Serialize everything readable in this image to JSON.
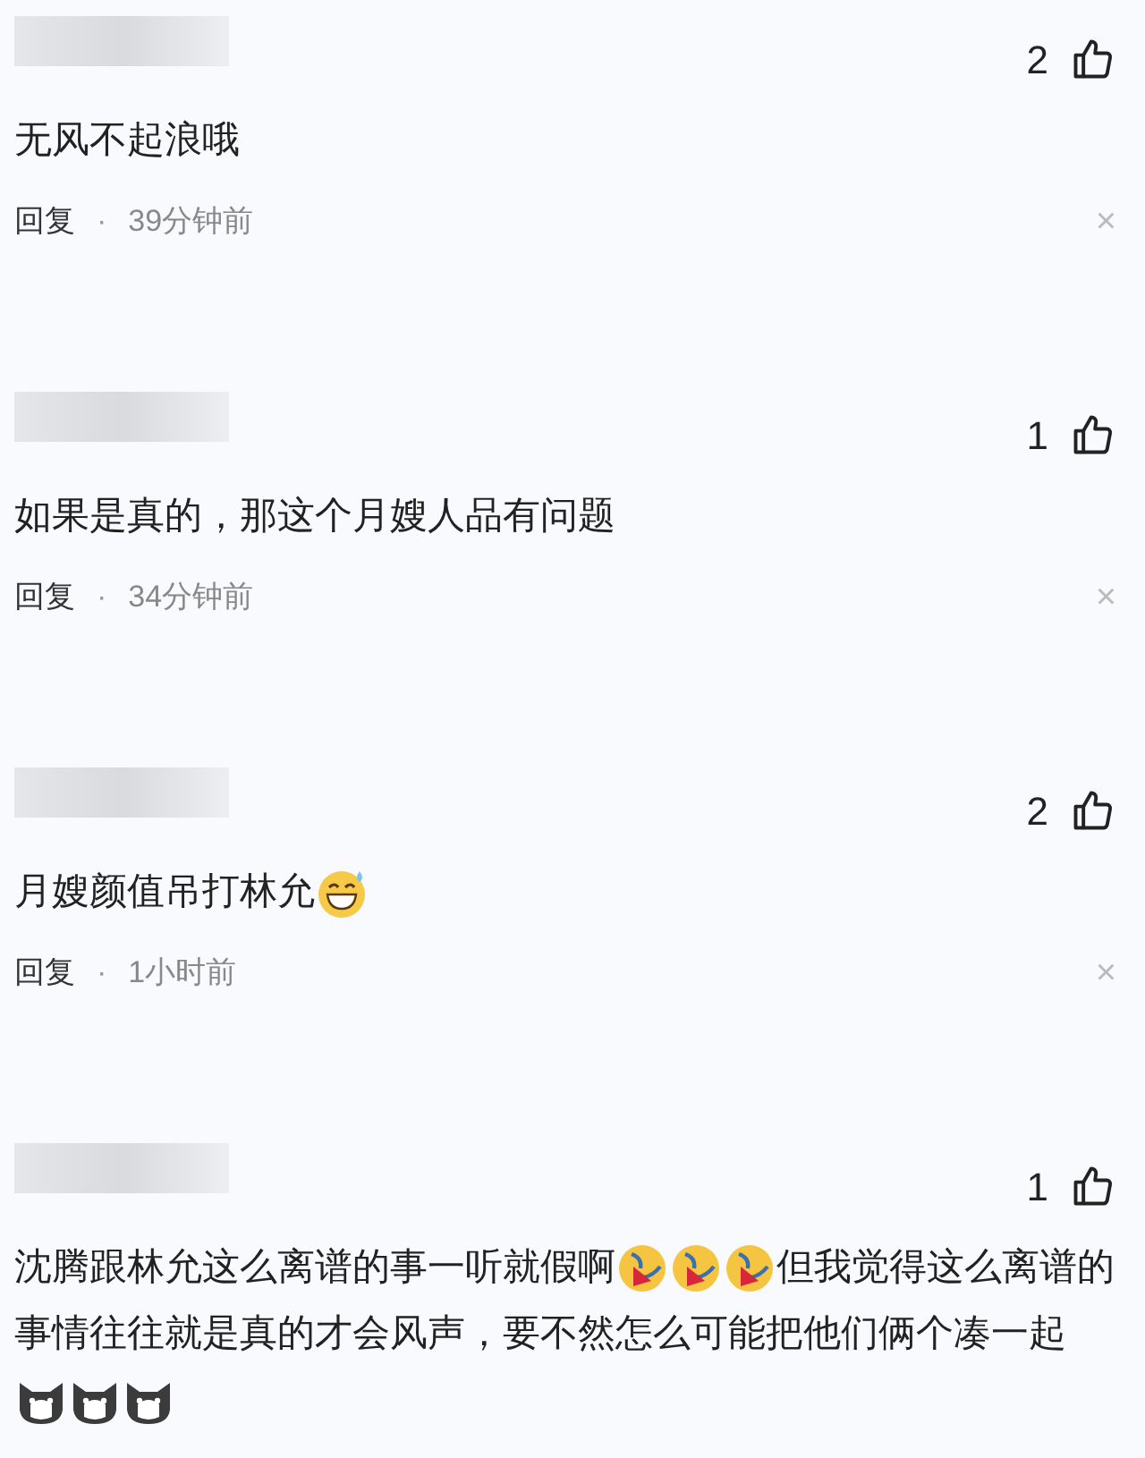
{
  "comments": [
    {
      "likes": "2",
      "body": [
        {
          "kind": "text",
          "text": "无风不起浪哦"
        }
      ],
      "reply": "回复",
      "separator": "·",
      "time": "39分钟前",
      "close": "×"
    },
    {
      "likes": "1",
      "body": [
        {
          "kind": "text",
          "text": "如果是真的，那这个月嫂人品有问题"
        }
      ],
      "reply": "回复",
      "separator": "·",
      "time": "34分钟前",
      "close": "×"
    },
    {
      "likes": "2",
      "body": [
        {
          "kind": "text",
          "text": "月嫂颜值吊打林允"
        },
        {
          "kind": "grin-sweat"
        }
      ],
      "reply": "回复",
      "separator": "·",
      "time": "1小时前",
      "close": "×"
    },
    {
      "likes": "1",
      "body": [
        {
          "kind": "text",
          "text": "沈腾跟林允这么离谱的事一听就假啊"
        },
        {
          "kind": "rofl"
        },
        {
          "kind": "rofl"
        },
        {
          "kind": "rofl"
        },
        {
          "kind": "text",
          "text": "但我觉得这么离谱的事情往往就是真的才会风声，要不然怎么可能把他们俩个凑一起"
        },
        {
          "kind": "cat"
        },
        {
          "kind": "cat"
        },
        {
          "kind": "cat"
        }
      ]
    }
  ]
}
